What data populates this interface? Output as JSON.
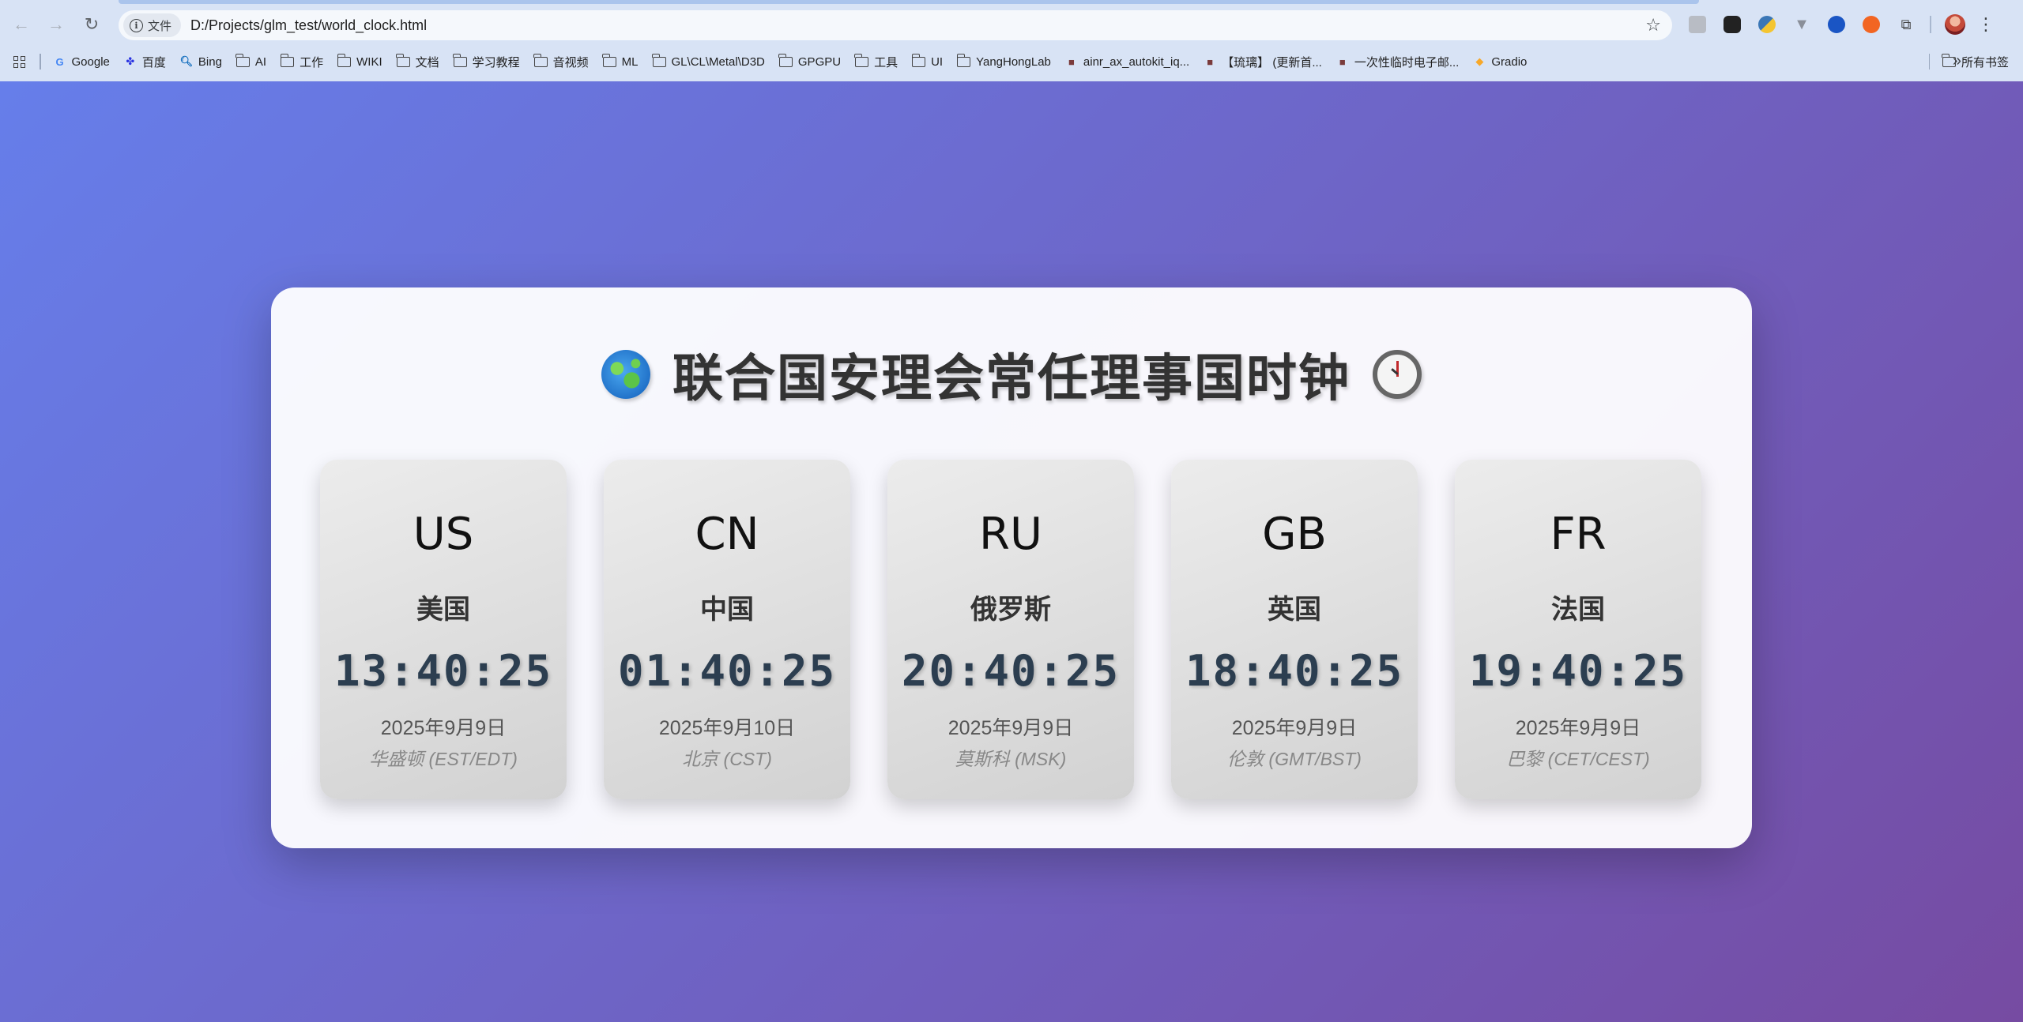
{
  "browser": {
    "site_chip_label": "文件",
    "url": "D:/Projects/glm_test/world_clock.html",
    "bookmarks": [
      {
        "label": "Google",
        "icon": "google-icon"
      },
      {
        "label": "百度",
        "icon": "baidu-icon"
      },
      {
        "label": "Bing",
        "icon": "bing-icon"
      },
      {
        "label": "AI",
        "icon": "folder-icon"
      },
      {
        "label": "工作",
        "icon": "folder-icon"
      },
      {
        "label": "WIKI",
        "icon": "folder-icon"
      },
      {
        "label": "文档",
        "icon": "folder-icon"
      },
      {
        "label": "学习教程",
        "icon": "folder-icon"
      },
      {
        "label": "音视频",
        "icon": "folder-icon"
      },
      {
        "label": "ML",
        "icon": "folder-icon"
      },
      {
        "label": "GL\\CL\\Metal\\D3D",
        "icon": "folder-icon"
      },
      {
        "label": "GPGPU",
        "icon": "folder-icon"
      },
      {
        "label": "工具",
        "icon": "folder-icon"
      },
      {
        "label": "UI",
        "icon": "folder-icon"
      },
      {
        "label": "YangHongLab",
        "icon": "folder-icon"
      },
      {
        "label": "ainr_ax_autokit_iq...",
        "icon": "site-icon"
      },
      {
        "label": "【琉璃】 (更新首...",
        "icon": "site-icon"
      },
      {
        "label": "一次性临时电子邮...",
        "icon": "site-icon"
      },
      {
        "label": "Gradio",
        "icon": "gradio-icon"
      }
    ],
    "all_bookmarks_label": "所有书签"
  },
  "page": {
    "title": "联合国安理会常任理事国时钟",
    "clocks": [
      {
        "code": "US",
        "country": "美国",
        "time": "13:40:25",
        "date": "2025年9月9日",
        "timezone": "华盛顿 (EST/EDT)"
      },
      {
        "code": "CN",
        "country": "中国",
        "time": "01:40:25",
        "date": "2025年9月10日",
        "timezone": "北京 (CST)"
      },
      {
        "code": "RU",
        "country": "俄罗斯",
        "time": "20:40:25",
        "date": "2025年9月9日",
        "timezone": "莫斯科 (MSK)"
      },
      {
        "code": "GB",
        "country": "英国",
        "time": "18:40:25",
        "date": "2025年9月9日",
        "timezone": "伦敦 (GMT/BST)"
      },
      {
        "code": "FR",
        "country": "法国",
        "time": "19:40:25",
        "date": "2025年9月9日",
        "timezone": "巴黎 (CET/CEST)"
      }
    ]
  },
  "colors": {
    "gradient_start": "#667eea",
    "gradient_end": "#764ba2",
    "time_color": "#2c3e50"
  }
}
